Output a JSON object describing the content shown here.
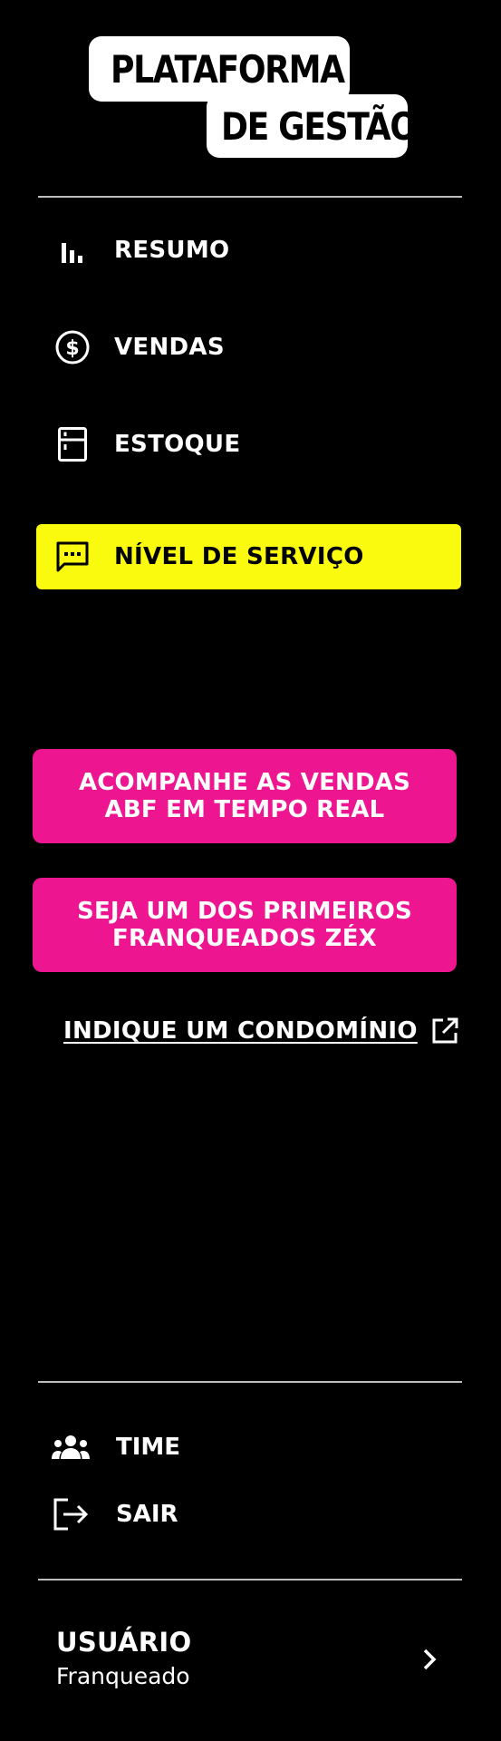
{
  "logo": {
    "line1": "PLATAFORMA",
    "line2": "DE GESTÃO"
  },
  "nav": {
    "items": [
      {
        "label": "RESUMO",
        "icon": "bar-chart-icon",
        "active": false
      },
      {
        "label": "VENDAS",
        "icon": "dollar-circle-icon",
        "active": false
      },
      {
        "label": "ESTOQUE",
        "icon": "fridge-icon",
        "active": false
      },
      {
        "label": "NÍVEL DE SERVIÇO",
        "icon": "chat-dots-icon",
        "active": true
      }
    ]
  },
  "cta": {
    "abf_line1": "ACOMPANHE AS VENDAS",
    "abf_line2": "ABF EM TEMPO REAL",
    "zex_line1": "SEJA UM DOS PRIMEIROS",
    "zex_line2": "FRANQUEADOS ZÉX"
  },
  "external_link": {
    "label": "INDIQUE UM CONDOMÍNIO",
    "icon": "external-link-icon"
  },
  "bottom": {
    "team_label": "TIME",
    "team_icon": "group-icon",
    "logout_label": "SAIR",
    "logout_icon": "logout-icon"
  },
  "user": {
    "title": "USUÁRIO",
    "role": "Franqueado",
    "icon": "chevron-right-icon"
  },
  "colors": {
    "background": "#000000",
    "active_nav": "#fafa0f",
    "cta": "#ee1590",
    "text": "#ffffff"
  }
}
